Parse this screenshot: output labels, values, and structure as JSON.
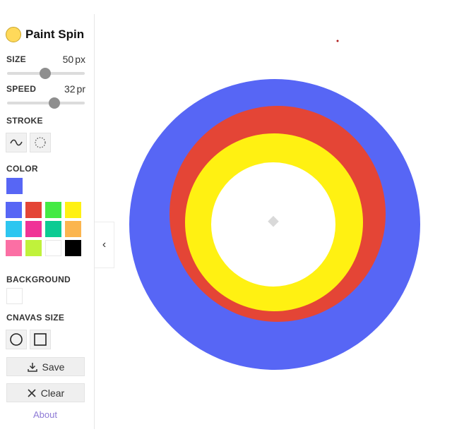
{
  "app": {
    "title": "Paint Spin"
  },
  "size": {
    "label": "SIZE",
    "value": "50",
    "unit": "px",
    "slider_fraction": 0.49
  },
  "speed": {
    "label": "SPEED",
    "value": "32",
    "unit": "pr",
    "slider_fraction": 0.61
  },
  "stroke": {
    "label": "STROKE",
    "options": [
      "wave",
      "dotted-circle"
    ]
  },
  "color": {
    "label": "COLOR",
    "selected": "#5766f5",
    "palette": [
      "#5766f5",
      "#e44536",
      "#44ea44",
      "#fff112",
      "#2dc6f0",
      "#f03397",
      "#0dcb93",
      "#fbb54e",
      "#fb6fa4",
      "#c0f23b",
      "#ffffff",
      "#000000"
    ]
  },
  "background": {
    "label": "BACKGROUND",
    "color": "#ffffff"
  },
  "canvas_size": {
    "label": "CNAVAS SIZE",
    "options": [
      "circle",
      "square"
    ]
  },
  "actions": {
    "save_label": "Save",
    "clear_label": "Clear",
    "about_label": "About"
  },
  "collapse": {
    "glyph": "‹"
  },
  "drawing": {
    "rings": [
      {
        "color": "#5766f5"
      },
      {
        "color": "#e44536"
      },
      {
        "color": "#fff112"
      },
      {
        "color": "#ffffff"
      }
    ]
  }
}
